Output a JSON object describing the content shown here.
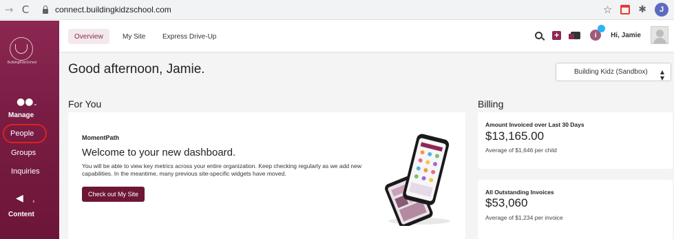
{
  "browser": {
    "url": "connect.buildingkidzschool.com",
    "back_icon": "arrow-left-icon",
    "reload_icon": "reload-icon",
    "profile_initial": "J"
  },
  "sidebar": {
    "logo_text": "BuildingKidzSchool",
    "manage_label": "Manage",
    "items": [
      {
        "label": "People"
      },
      {
        "label": "Groups"
      },
      {
        "label": "Inquiries"
      }
    ],
    "content_label": "Content"
  },
  "topnav": {
    "tabs": [
      {
        "label": "Overview",
        "active": true
      },
      {
        "label": "My Site",
        "active": false
      },
      {
        "label": "Express Drive-Up",
        "active": false
      }
    ],
    "plus_glyph": "+",
    "info_glyph": "i",
    "greeting": "Hi, Jamie"
  },
  "page": {
    "title": "Good afternoon, Jamie.",
    "site_select": "Building Kidz (Sandbox)"
  },
  "for_you": {
    "section_title": "For You",
    "brand": "MomentPath",
    "heading": "Welcome to your new dashboard.",
    "body": "You will be able to view key metrics across your entire organization. Keep checking regularly as we add new capabilities. In the meantime, many previous site-specific widgets have moved.",
    "button": "Check out My Site"
  },
  "billing": {
    "section_title": "Billing",
    "cards": [
      {
        "label": "Amount Invoiced over Last 30 Days",
        "value": "$13,165.00",
        "sub": "Average of $1,646 per child"
      },
      {
        "label": "All Outstanding Invoices",
        "value": "$53,060",
        "sub": "Average of $1,234 per invoice"
      }
    ]
  },
  "colors": {
    "brand": "#8c2852",
    "button": "#6e1636",
    "highlight_circle": "#e02020"
  }
}
